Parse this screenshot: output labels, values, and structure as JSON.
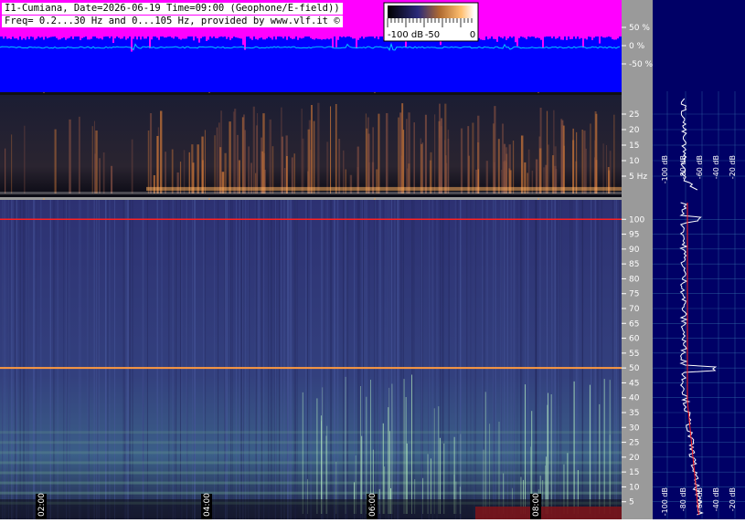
{
  "header": {
    "line1": "I1-Cumiana, Date=2026-06-19 Time=09:00 (Geophone/E-field))",
    "line2": "Freq= 0.2...30 Hz and 0...105 Hz, provided by www.vlf.it ©"
  },
  "colorbar": {
    "labels": [
      "-100 dB",
      "-50",
      "0"
    ]
  },
  "colors": {
    "waveform_bg": "#0000ff",
    "envelope": "#ff00ff",
    "trace": "#00c8ff",
    "spectro_bg": "#2c2f6e",
    "side_bg": "#000066",
    "marker_red": "#ff2020",
    "time_line": "#ffa040"
  },
  "chart_data": [
    {
      "type": "line",
      "panel": "waveform",
      "y_ticks": [
        "50 %",
        "0 %",
        "-50 %"
      ],
      "ylim": [
        -100,
        100
      ]
    },
    {
      "type": "heatmap",
      "panel": "spectrogram-low",
      "ylim": [
        0,
        30
      ],
      "y_ticks": [
        "25",
        "20",
        "15",
        "10",
        "5 Hz"
      ],
      "time_markers": [
        "02:00",
        "04:00",
        "06:00",
        "08:00"
      ]
    },
    {
      "type": "heatmap",
      "panel": "spectrogram-high",
      "ylim": [
        0,
        105
      ],
      "y_ticks": [
        "100",
        "95",
        "90",
        "85",
        "80",
        "75",
        "70",
        "65",
        "60",
        "55",
        "50",
        "45",
        "40",
        "35",
        "30",
        "25",
        "20",
        "15",
        "10",
        "5"
      ],
      "x_ticks": [
        "02:00",
        "04:00",
        "06:00",
        "08:00"
      ],
      "hum_line_hz": 50,
      "marker_line_hz": 100
    },
    {
      "type": "line",
      "panel": "spectrum-side",
      "x_ticks": [
        "-100 dB",
        "-80 dB",
        "-60 dB",
        "-40 dB",
        "-20 dB"
      ]
    }
  ]
}
